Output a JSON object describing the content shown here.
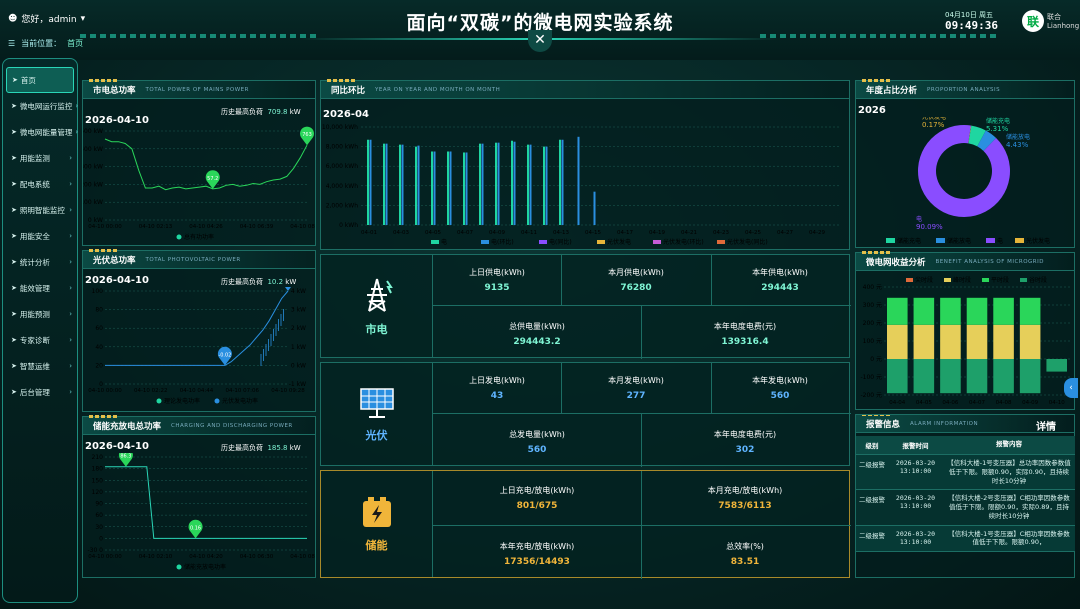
{
  "header": {
    "title": "面向“双碳”的微电网实验系统",
    "user": "您好，admin",
    "breadcrumb_label": "当前位置：",
    "breadcrumb_value": "首页",
    "date": "04月10日 周五",
    "time": "09:49:36",
    "logo_text": "联合",
    "logo_sub": "Lianhong",
    "close": "✕"
  },
  "sidebar": {
    "items": [
      {
        "label": "首页",
        "active": true,
        "arrow": ""
      },
      {
        "label": "微电网运行监控",
        "arrow": "›"
      },
      {
        "label": "微电网能量管理",
        "arrow": "›"
      },
      {
        "label": "用能监测",
        "arrow": "›"
      },
      {
        "label": "配电系统",
        "arrow": "›"
      },
      {
        "label": "照明智能监控",
        "arrow": "›"
      },
      {
        "label": "用能安全",
        "arrow": "›"
      },
      {
        "label": "统计分析",
        "arrow": "›"
      },
      {
        "label": "能效管理",
        "arrow": "›"
      },
      {
        "label": "用能预测",
        "arrow": "›"
      },
      {
        "label": "专家诊断",
        "arrow": "›"
      },
      {
        "label": "智慧运维",
        "arrow": "›"
      },
      {
        "label": "后台管理",
        "arrow": "›"
      }
    ]
  },
  "mains": {
    "title": "市电总功率",
    "subtitle": "TOTAL POWER OF MAINS POWER",
    "date": "2026-04-10",
    "hist_label": "历史最高负荷",
    "hist_value": "709.8",
    "unit": "kW"
  },
  "pv": {
    "title": "光伏总功率",
    "subtitle": "TOTAL PHOTOVOLTAIC POWER",
    "date": "2026-04-10",
    "hist_label": "历史最高负荷",
    "hist_value": "10.2",
    "unit": "kW"
  },
  "storage": {
    "title": "储能充放电总功率",
    "subtitle": "CHARGING AND DISCHARGING POWER",
    "date": "2026-04-10",
    "hist_label": "历史最高负荷",
    "hist_value": "185.8",
    "unit": "kW"
  },
  "yoy": {
    "title": "同比环比",
    "subtitle": "YEAR ON YEAR AND MONTH ON MONTH",
    "date": "2026-04"
  },
  "proportion": {
    "title": "年度占比分析",
    "subtitle": "PROPORTION ANALYSIS",
    "year": "2026"
  },
  "benefit": {
    "title": "微电网收益分析",
    "subtitle": "BENEFIT ANALYSIS OF MICROGRID"
  },
  "alarm": {
    "title": "报警信息",
    "subtitle": "ALARM INFORMATION",
    "detail": "详情",
    "headers": [
      "级别",
      "报警时间",
      "报警内容"
    ],
    "rows": [
      {
        "level": "二级报警",
        "time": "2026-03-20 13:10:00",
        "content": "【信科大楼-1号变压器】总功率因数参数值低于下限。限额0.90，实际0.90，且持续时长10分钟"
      },
      {
        "level": "二级报警",
        "time": "2026-03-20 13:10:00",
        "content": "【信科大楼-2号变压器】C相功率因数参数值低于下限。限额0.90，实际0.89，且持续时长10分钟"
      },
      {
        "level": "二级报警",
        "time": "2026-03-20 13:10:00",
        "content": "【信科大楼-1号变压器】C相功率因数参数值低于下限。限额0.90，"
      }
    ]
  },
  "cards": {
    "grid": {
      "name": "市电",
      "k1": "上日供电(kWh)",
      "v1": "9135",
      "k2": "本月供电(kWh)",
      "v2": "76280",
      "k3": "本年供电(kWh)",
      "v3": "294443",
      "k4": "总供电量(kWh)",
      "v4": "294443.2",
      "k5": "本年电度电费(元)",
      "v5": "139316.4",
      "color": "#7ff5d4"
    },
    "solar": {
      "name": "光伏",
      "k1": "上日发电(kWh)",
      "v1": "43",
      "k2": "本月发电(kWh)",
      "v2": "277",
      "k3": "本年发电(kWh)",
      "v3": "560",
      "k4": "总发电量(kWh)",
      "v4": "560",
      "k5": "本年电度电费(元)",
      "v5": "302",
      "color": "#5fb4ff"
    },
    "ess": {
      "name": "储能",
      "k1": "上日充电/放电(kWh)",
      "v1": "801/675",
      "k2": "本月充电/放电(kWh)",
      "v2": "7583/6113",
      "k3": "本年充电/放电(kWh)",
      "v3": "17356/14493",
      "k4": "总效率(%)",
      "v4": "83.51",
      "color": "#f0b53a"
    }
  },
  "chart_data": [
    {
      "id": "mains",
      "type": "line",
      "x": [
        "04-10 00:00",
        "04-10 02:13",
        "04-10 04:26",
        "04-10 06:39",
        "04-10 08:52"
      ],
      "yticks": [
        "0 kW",
        "100 kW",
        "200 kW",
        "300 kW",
        "400 kW",
        "500 kW"
      ],
      "ylim": [
        0,
        500
      ],
      "legend": [
        "总有功功率"
      ],
      "marker_values": [
        "57.2",
        "763"
      ],
      "values": [
        455,
        440,
        440,
        430,
        400,
        280,
        180,
        180,
        190,
        170,
        180,
        185,
        175,
        180,
        185,
        190,
        175,
        180,
        195,
        200,
        190,
        195,
        205,
        200,
        215,
        225,
        230,
        245,
        290,
        350,
        420
      ]
    },
    {
      "id": "pv",
      "type": "line",
      "x": [
        "04-10 00:00",
        "04-10 02:22",
        "04-10 04:44",
        "04-10 07:06",
        "04-10 09:28"
      ],
      "yticks_left": [
        "0",
        "20",
        "40",
        "60",
        "80",
        "100"
      ],
      "yticks_right": [
        "-1 kW",
        "0 kW",
        "1 kW",
        "2 kW",
        "3 kW",
        "4 kW"
      ],
      "legend": [
        "理论发电功率",
        "光伏发电功率"
      ],
      "marker_values": [
        "-0.02",
        "10.2"
      ],
      "values": [
        0,
        0,
        0,
        0,
        0,
        0,
        0,
        0,
        0,
        0,
        0,
        0,
        0,
        0,
        0,
        0,
        0,
        0,
        0,
        0,
        0.2,
        0.5,
        0.8,
        1.1,
        1.5,
        1.9,
        2.4,
        3.0,
        3.6,
        4.0
      ]
    },
    {
      "id": "storage",
      "type": "line",
      "x": [
        "04-10 00:00",
        "04-10 02:10",
        "04-10 04:20",
        "04-10 06:30",
        "04-10 08:40"
      ],
      "yticks": [
        "-30 0",
        "0",
        "30",
        "60",
        "90",
        "120",
        "150",
        "180",
        "210"
      ],
      "ylim": [
        -30,
        210
      ],
      "legend": [
        "储能充放电功率"
      ],
      "marker_values": [
        "86.3",
        "0.16"
      ],
      "values": [
        185,
        185,
        185,
        185,
        185,
        185,
        185,
        0,
        0,
        0,
        0,
        0,
        0,
        0,
        0,
        0,
        0,
        0,
        0,
        0,
        0,
        0,
        0,
        0,
        0,
        0,
        0,
        0,
        0,
        0
      ]
    },
    {
      "id": "yoy",
      "type": "bar",
      "categories": [
        "04-01",
        "04-03",
        "04-05",
        "04-07",
        "04-09",
        "04-11",
        "04-13",
        "04-15",
        "04-17",
        "04-19",
        "04-21",
        "04-23",
        "04-25",
        "04-27",
        "04-29"
      ],
      "yticks": [
        "0 kWh",
        "2,000 kWh",
        "4,000 kWh",
        "6,000 kWh",
        "8,000 kWh",
        "10,000 kWh"
      ],
      "ylim": [
        0,
        10000
      ],
      "legend": [
        "电",
        "电(环比)",
        "电(同比)",
        "光伏发电",
        "光伏发电(环比)",
        "光伏发电(同比)"
      ],
      "series": [
        {
          "name": "电",
          "values": [
            8700,
            8300,
            8200,
            8000,
            7500,
            7500,
            7400,
            8300,
            8400,
            8600,
            8200,
            8000,
            8700,
            0,
            0,
            0,
            0,
            0,
            0,
            0,
            0,
            0,
            0,
            0,
            0,
            0,
            0,
            0,
            0,
            0
          ]
        },
        {
          "name": "电(环比)",
          "values": [
            8700,
            8300,
            8200,
            8100,
            7500,
            7500,
            7400,
            8300,
            8400,
            8500,
            8200,
            8000,
            8700,
            9000,
            3400,
            0,
            0,
            0,
            0,
            0,
            0,
            0,
            0,
            0,
            0,
            0,
            0,
            0,
            0,
            0
          ]
        }
      ]
    },
    {
      "id": "proportion",
      "type": "pie",
      "labels": [
        "光伏发电",
        "储能充电",
        "储能放电",
        "电"
      ],
      "values": [
        0.17,
        5.31,
        4.43,
        90.09
      ],
      "display": [
        "0.17%",
        "5.31%",
        "4.43%",
        "90.09%"
      ],
      "colors": [
        "#e6b53a",
        "#1fd6a1",
        "#2a8fe0",
        "#8a4dff"
      ],
      "legend": [
        "储能充电",
        "储能放电",
        "电",
        "光伏发电"
      ]
    },
    {
      "id": "benefit",
      "type": "bar",
      "categories": [
        "04-04",
        "04-05",
        "04-06",
        "04-07",
        "04-08",
        "04-09",
        "04-10"
      ],
      "yticks": [
        "-200 元",
        "-100 元",
        "0 元",
        "100 元",
        "200 元",
        "300 元",
        "400 元"
      ],
      "ylim": [
        -200,
        400
      ],
      "legend": [
        "尖时段",
        "峰时段",
        "平时段",
        "谷时段"
      ],
      "series": [
        {
          "name": "峰时段",
          "values": [
            190,
            190,
            190,
            190,
            190,
            190,
            0
          ]
        },
        {
          "name": "平时段",
          "values": [
            150,
            150,
            150,
            150,
            150,
            150,
            0
          ]
        },
        {
          "name": "谷时段",
          "values": [
            -190,
            -190,
            -190,
            -190,
            -190,
            -190,
            -70
          ]
        }
      ]
    }
  ]
}
